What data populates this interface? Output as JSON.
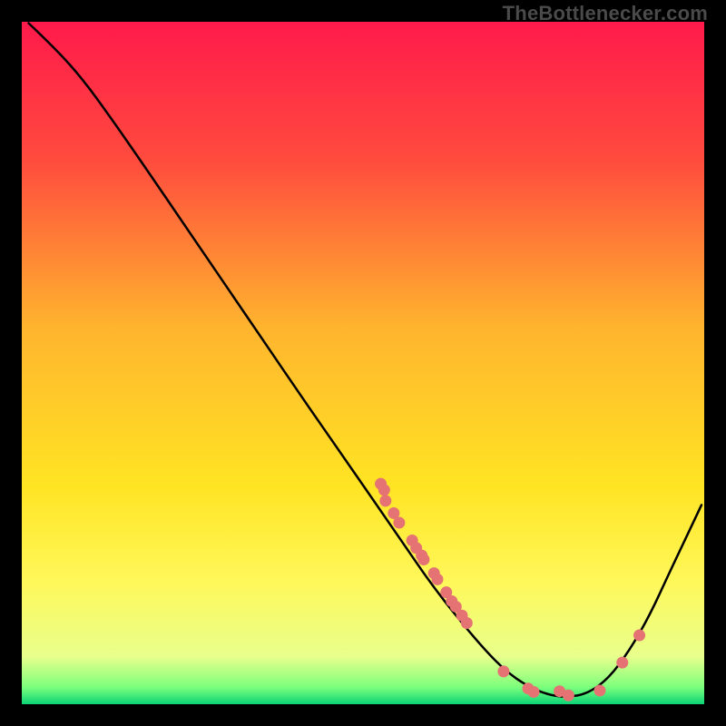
{
  "watermark": "TheBottlenecker.com",
  "chart_data": {
    "type": "line",
    "title": "",
    "xlabel": "",
    "ylabel": "",
    "xlim": [
      0,
      100
    ],
    "ylim": [
      0,
      100
    ],
    "grid": false,
    "legend": false,
    "background_gradient": {
      "stops": [
        {
          "offset": 0.0,
          "color": "#ff1a4b"
        },
        {
          "offset": 0.2,
          "color": "#ff4a3e"
        },
        {
          "offset": 0.45,
          "color": "#ffb52e"
        },
        {
          "offset": 0.68,
          "color": "#ffe423"
        },
        {
          "offset": 0.82,
          "color": "#fff85a"
        },
        {
          "offset": 0.93,
          "color": "#e8ff8c"
        },
        {
          "offset": 0.975,
          "color": "#7cff7c"
        },
        {
          "offset": 1.0,
          "color": "#0bd477"
        }
      ]
    },
    "series": [
      {
        "name": "bottleneck-curve",
        "color": "#000000",
        "points": [
          {
            "x": 1.0,
            "y": 99.8
          },
          {
            "x": 5.0,
            "y": 96.0
          },
          {
            "x": 9.0,
            "y": 91.5
          },
          {
            "x": 13.0,
            "y": 86.0
          },
          {
            "x": 18.0,
            "y": 78.8
          },
          {
            "x": 24.0,
            "y": 70.0
          },
          {
            "x": 30.0,
            "y": 61.2
          },
          {
            "x": 36.0,
            "y": 52.4
          },
          {
            "x": 42.0,
            "y": 43.6
          },
          {
            "x": 48.0,
            "y": 35.0
          },
          {
            "x": 52.0,
            "y": 29.2
          },
          {
            "x": 56.0,
            "y": 23.4
          },
          {
            "x": 60.0,
            "y": 17.6
          },
          {
            "x": 64.0,
            "y": 12.5
          },
          {
            "x": 68.0,
            "y": 7.8
          },
          {
            "x": 71.0,
            "y": 4.8
          },
          {
            "x": 74.0,
            "y": 2.7
          },
          {
            "x": 77.0,
            "y": 1.4
          },
          {
            "x": 80.0,
            "y": 1.0
          },
          {
            "x": 83.0,
            "y": 1.6
          },
          {
            "x": 86.0,
            "y": 3.8
          },
          {
            "x": 89.0,
            "y": 7.8
          },
          {
            "x": 92.0,
            "y": 13.0
          },
          {
            "x": 95.0,
            "y": 19.5
          },
          {
            "x": 98.0,
            "y": 25.8
          },
          {
            "x": 99.6,
            "y": 29.2
          }
        ]
      }
    ],
    "scatter": {
      "name": "data-points",
      "color": "#e57373",
      "radius": 6.5,
      "points": [
        {
          "x": 52.6,
          "y": 32.3
        },
        {
          "x": 53.1,
          "y": 31.4
        },
        {
          "x": 53.3,
          "y": 29.8
        },
        {
          "x": 54.5,
          "y": 28.0
        },
        {
          "x": 55.3,
          "y": 26.6
        },
        {
          "x": 57.2,
          "y": 24.0
        },
        {
          "x": 57.8,
          "y": 22.9
        },
        {
          "x": 58.6,
          "y": 21.8
        },
        {
          "x": 58.9,
          "y": 21.2
        },
        {
          "x": 60.4,
          "y": 19.2
        },
        {
          "x": 60.9,
          "y": 18.3
        },
        {
          "x": 62.2,
          "y": 16.4
        },
        {
          "x": 63.0,
          "y": 15.1
        },
        {
          "x": 63.6,
          "y": 14.3
        },
        {
          "x": 64.5,
          "y": 13.0
        },
        {
          "x": 65.2,
          "y": 11.9
        },
        {
          "x": 70.6,
          "y": 4.8
        },
        {
          "x": 74.2,
          "y": 2.3
        },
        {
          "x": 75.0,
          "y": 1.8
        },
        {
          "x": 78.8,
          "y": 1.9
        },
        {
          "x": 80.1,
          "y": 1.3
        },
        {
          "x": 84.7,
          "y": 2.0
        },
        {
          "x": 88.0,
          "y": 6.1
        },
        {
          "x": 90.5,
          "y": 10.1
        }
      ]
    }
  }
}
